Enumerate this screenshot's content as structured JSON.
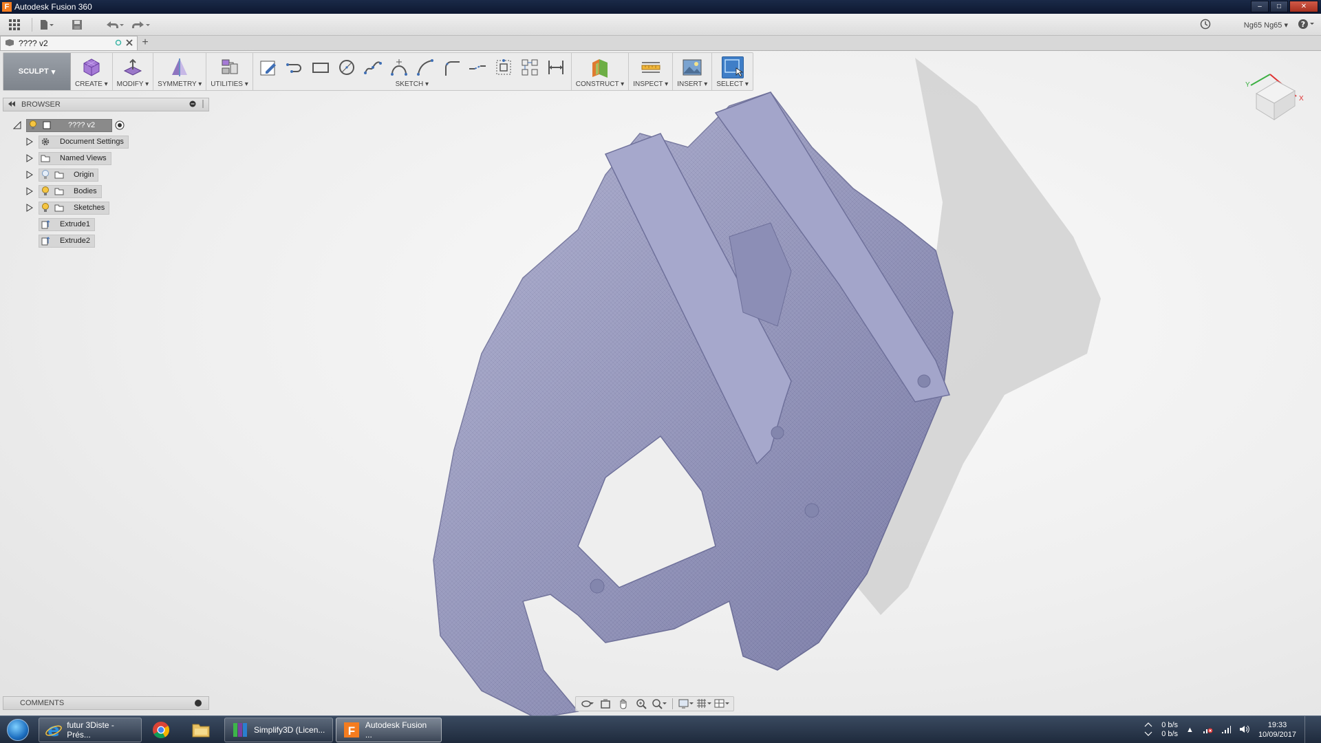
{
  "window": {
    "title": "Autodesk Fusion 360"
  },
  "quick_access": {
    "user_label": "Ng65 Ng65"
  },
  "document_tab": {
    "name": "???? v2"
  },
  "workspace": {
    "label": "SCULPT"
  },
  "toolbar": {
    "create": "CREATE",
    "modify": "MODIFY",
    "symmetry": "SYMMETRY",
    "utilities": "UTILITIES",
    "sketch": "SKETCH",
    "construct": "CONSTRUCT",
    "inspect": "INSPECT",
    "insert": "INSERT",
    "select": "SELECT"
  },
  "browser": {
    "title": "BROWSER",
    "root": "???? v2",
    "items": [
      {
        "label": "Document Settings"
      },
      {
        "label": "Named Views"
      },
      {
        "label": "Origin"
      },
      {
        "label": "Bodies"
      },
      {
        "label": "Sketches"
      },
      {
        "label": "Extrude1"
      },
      {
        "label": "Extrude2"
      }
    ]
  },
  "comments": {
    "title": "COMMENTS"
  },
  "taskbar": {
    "items": [
      {
        "label": "futur 3Diste - Prés..."
      },
      {
        "label": ""
      },
      {
        "label": ""
      },
      {
        "label": "Simplify3D (Licen..."
      },
      {
        "label": "Autodesk Fusion ..."
      }
    ],
    "net_up": "0 b/s",
    "net_down": "0 b/s",
    "time": "19:33",
    "date": "10/09/2017"
  },
  "colors": {
    "model": "#9a9cc4",
    "select_accent": "#3f7ec7",
    "title_bar": "#0d1730",
    "app_logo": "#f57c1f"
  }
}
